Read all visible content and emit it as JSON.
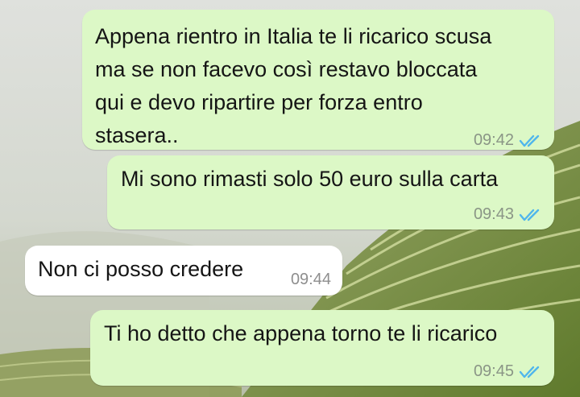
{
  "chat": {
    "messages": [
      {
        "direction": "outgoing",
        "text": "Appena rientro in Italia te li ricarico scusa\nma se non facevo così restavo bloccata\nqui e devo ripartire per forza entro\nstasera..",
        "time": "09:42",
        "status": "read",
        "status_icon": "double-check-icon"
      },
      {
        "direction": "outgoing",
        "text": "Mi sono rimasti solo 50 euro sulla carta",
        "time": "09:43",
        "status": "read",
        "status_icon": "double-check-icon"
      },
      {
        "direction": "incoming",
        "text": "Non ci posso credere",
        "time": "09:44"
      },
      {
        "direction": "outgoing",
        "text": "Ti ho detto che appena torno te li ricarico",
        "time": "09:45",
        "status": "read",
        "status_icon": "double-check-icon"
      }
    ]
  },
  "colors": {
    "outgoing_bubble": "#dcf8c6",
    "incoming_bubble": "#ffffff",
    "read_ticks": "#4fb6ec"
  }
}
